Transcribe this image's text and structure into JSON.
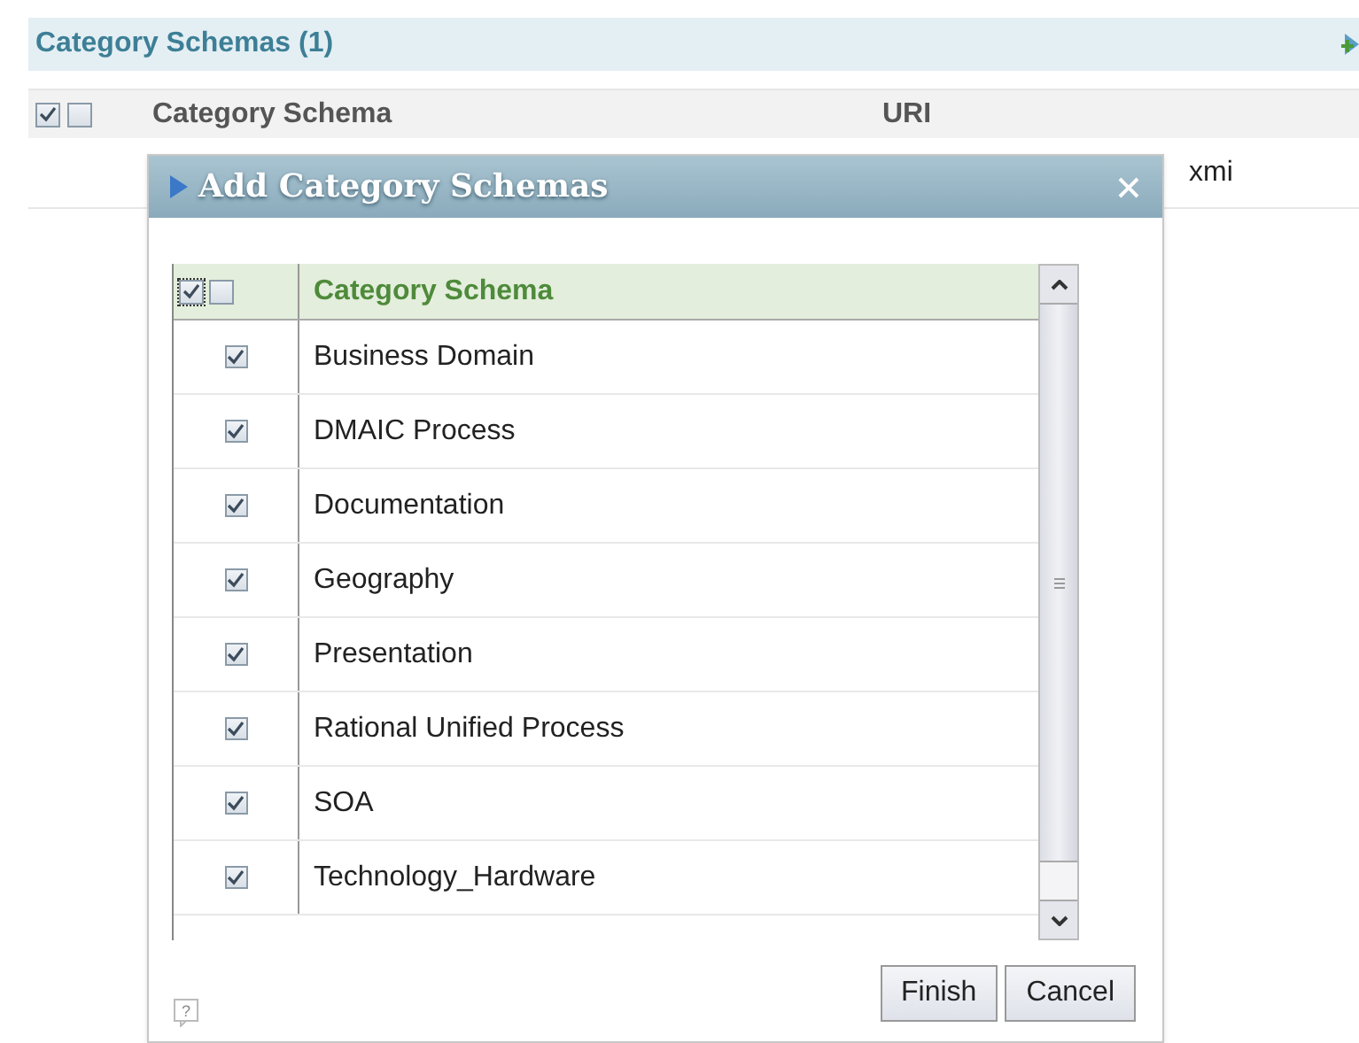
{
  "section": {
    "title": "Category Schemas (1)"
  },
  "table": {
    "select_all_checked": true,
    "select_none_checked": false,
    "columns": [
      "Category Schema",
      "URI"
    ],
    "rows": [
      {
        "uri": "xmi"
      }
    ]
  },
  "dialog": {
    "title": "Add Category Schemas",
    "select_all_checked": true,
    "select_none_checked": false,
    "column": "Category Schema",
    "rows": [
      {
        "label": "Business Domain",
        "checked": true
      },
      {
        "label": "DMAIC Process",
        "checked": true
      },
      {
        "label": "Documentation",
        "checked": true
      },
      {
        "label": "Geography",
        "checked": true
      },
      {
        "label": "Presentation",
        "checked": true
      },
      {
        "label": "Rational Unified Process",
        "checked": true
      },
      {
        "label": "SOA",
        "checked": true
      },
      {
        "label": "Technology_Hardware",
        "checked": true
      }
    ],
    "buttons": [
      "Finish",
      "Cancel"
    ],
    "help": "?"
  }
}
